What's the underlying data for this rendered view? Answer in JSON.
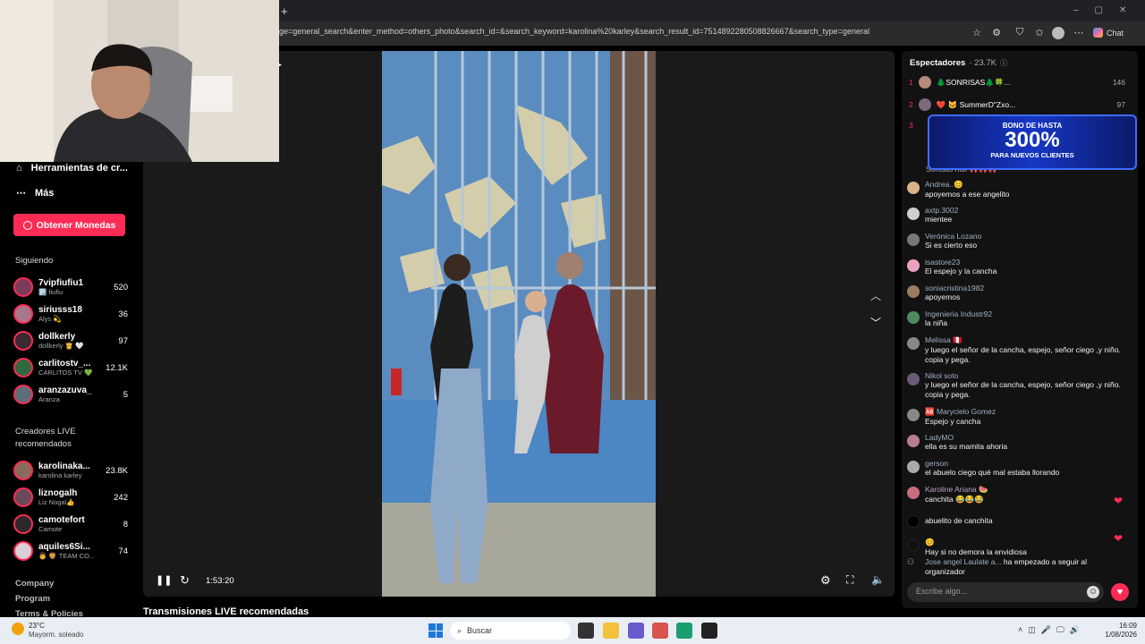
{
  "browser": {
    "url": "ge=general_search&enter_method=others_photo&search_id=&search_keyword=karolina%20karley&search_result_id=7514892280508826667&search_type=general",
    "new_tab": "+",
    "chat_label": "Chat"
  },
  "sidebar": {
    "nav": [
      {
        "label": "Herramientas de cr...",
        "icon": "home-icon"
      },
      {
        "label": "Más",
        "icon": "more-icon"
      }
    ],
    "coins_button": "Obtener Monedas",
    "following_header": "Siguiendo",
    "following": [
      {
        "name": "7vipfiufiu1",
        "sub": "🅿️ fiufiu",
        "count": "520"
      },
      {
        "name": "siriusss18",
        "sub": "Alys 💫",
        "count": "36"
      },
      {
        "name": "dollkerly",
        "sub": "dollkerly 👸 🤍",
        "count": "97"
      },
      {
        "name": "carlitostv_...",
        "sub": "CARLITOS TV 💚",
        "count": "12.1K"
      },
      {
        "name": "aranzazuva_",
        "sub": "Aranza",
        "count": "5"
      }
    ],
    "recommended_header": "Creadores LIVE recomendados",
    "recommended": [
      {
        "name": "karolinaka...",
        "sub": "karolina karley",
        "count": "23.8K"
      },
      {
        "name": "liznogalh",
        "sub": "Liz Nogal👍",
        "count": "242"
      },
      {
        "name": "camotefort",
        "sub": "Camote",
        "count": "8"
      },
      {
        "name": "aquiles6Si...",
        "sub": "👨 🦁 TEAM CO...",
        "count": "74"
      }
    ],
    "footer": [
      "Company",
      "Program",
      "Terms & Policies"
    ]
  },
  "player": {
    "time": "1:53:20",
    "bottom_title": "Transmisiones LIVE recomendadas"
  },
  "chat": {
    "viewers_title": "Espectadores",
    "viewers_count": "· 23.7K",
    "top": [
      {
        "rank": "1",
        "name": "🌲SONRISAS🌲🍀...",
        "count": "146"
      },
      {
        "rank": "2",
        "name": "❤️ 🐱 SummerD\"Zxo...",
        "count": "97"
      },
      {
        "rank": "3",
        "name": "",
        "count": ""
      }
    ],
    "promo": {
      "line1": "BONO DE HASTA",
      "line2": "300%",
      "line3": "PARA NUEVOS CLIENTES"
    },
    "partial": "Sonisas hull 🎀🎀🎀",
    "messages": [
      {
        "name": "Andrea..😊",
        "msg": "apoyemos a ese angelito",
        "color": "#d9b18a"
      },
      {
        "name": "axtp.3002",
        "msg": "mientee",
        "color": "#cfcfcf"
      },
      {
        "name": "Verónica Lozano",
        "msg": "Si es cierto eso",
        "color": "#777"
      },
      {
        "name": "isastore23",
        "msg": "El espejo y la cancha",
        "color": "#e9a3c0"
      },
      {
        "name": "soniacristina1982",
        "msg": "apoyemos",
        "color": "#9c7a62"
      },
      {
        "name": "Ingenieria Industr92",
        "msg": "la niña",
        "color": "#4e8a5e"
      },
      {
        "name": "Melissa 🇵🇪",
        "msg": "y luego el señor de la cancha, espejo, señor ciego ,y niño. copia y pega.",
        "color": "#888"
      },
      {
        "name": "Nikol soto",
        "msg": "y luego el señor de la cancha, espejo, señor ciego ,y niño. copia y pega.",
        "color": "#6a5a78"
      },
      {
        "name": "🆎 Marycielo Gomez",
        "msg": "Espejo y cancha",
        "color": "#888"
      },
      {
        "name": "LadyMO",
        "msg": "ella es su mamita ahoria",
        "color": "#b87f8f"
      },
      {
        "name": "gerson",
        "msg": "el abuelo ciego qué mal estaba llorando",
        "color": "#aaa"
      },
      {
        "name": "Karoline Ariana 🍉",
        "msg": "canchita 😂😂😂",
        "color": "#c96c7d"
      },
      {
        "name": "",
        "msg": "abuelito de canchita",
        "color": "#000"
      },
      {
        "name": "😊",
        "msg": "Hay si no demora la envidiosa",
        "color": "#111"
      }
    ],
    "follow_notice": {
      "name": "Jose angel Laulate a...",
      "msg": "ha empezado a seguir al organizador"
    },
    "input_placeholder": "Escribe algo..."
  },
  "taskbar": {
    "weather_temp": "23°C",
    "weather_desc": "Mayorm. soleado",
    "search": "Buscar",
    "time": "16:09",
    "date": "1/08/2026"
  },
  "colors": {
    "accent": "#fe2c55",
    "chat_bg": "#121212",
    "player_bg": "#1a1a1a"
  }
}
